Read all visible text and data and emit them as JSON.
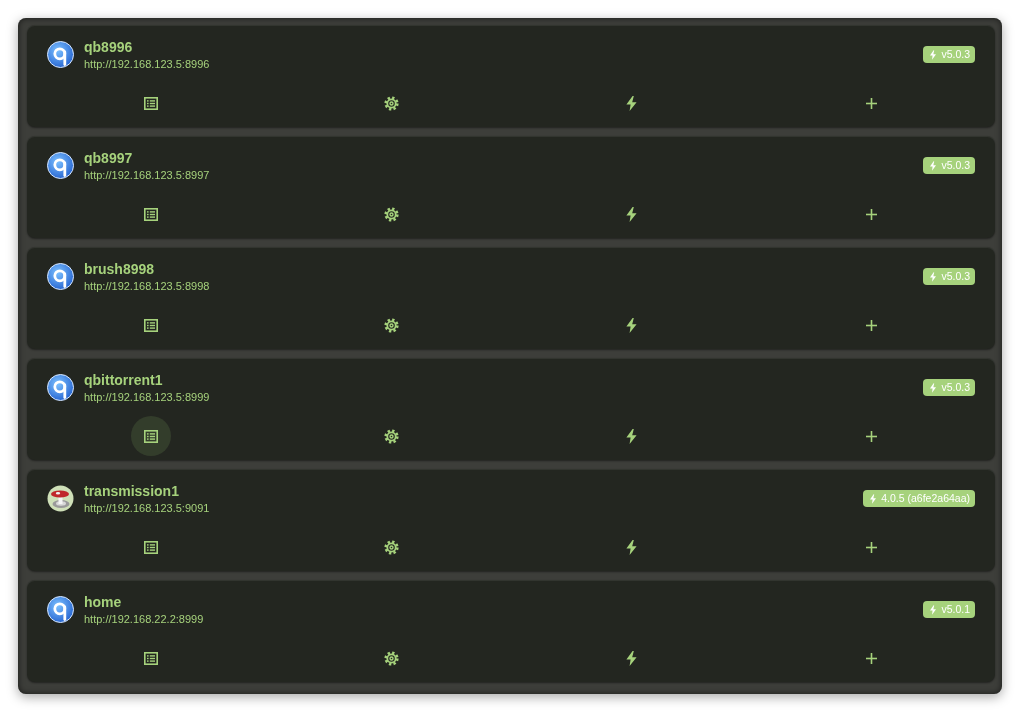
{
  "servers": [
    {
      "kind": "qbittorrent",
      "name": "qb8996",
      "url": "http://192.168.123.5:8996",
      "version": "v5.0.3",
      "actions": [
        {
          "kind": "list",
          "focused": false
        },
        {
          "kind": "settings",
          "focused": false
        },
        {
          "kind": "bolt",
          "focused": false
        },
        {
          "kind": "add",
          "focused": false
        }
      ]
    },
    {
      "kind": "qbittorrent",
      "name": "qb8997",
      "url": "http://192.168.123.5:8997",
      "version": "v5.0.3",
      "actions": [
        {
          "kind": "list",
          "focused": false
        },
        {
          "kind": "settings",
          "focused": false
        },
        {
          "kind": "bolt",
          "focused": false
        },
        {
          "kind": "add",
          "focused": false
        }
      ]
    },
    {
      "kind": "qbittorrent",
      "name": "brush8998",
      "url": "http://192.168.123.5:8998",
      "version": "v5.0.3",
      "actions": [
        {
          "kind": "list",
          "focused": false
        },
        {
          "kind": "settings",
          "focused": false
        },
        {
          "kind": "bolt",
          "focused": false
        },
        {
          "kind": "add",
          "focused": false
        }
      ]
    },
    {
      "kind": "qbittorrent",
      "name": "qbittorrent1",
      "url": "http://192.168.123.5:8999",
      "version": "v5.0.3",
      "actions": [
        {
          "kind": "list",
          "focused": true
        },
        {
          "kind": "settings",
          "focused": false
        },
        {
          "kind": "bolt",
          "focused": false
        },
        {
          "kind": "add",
          "focused": false
        }
      ]
    },
    {
      "kind": "transmission",
      "name": "transmission1",
      "url": "http://192.168.123.5:9091",
      "version": "4.0.5 (a6fe2a64aa)",
      "actions": [
        {
          "kind": "list",
          "focused": false
        },
        {
          "kind": "settings",
          "focused": false
        },
        {
          "kind": "bolt",
          "focused": false
        },
        {
          "kind": "add",
          "focused": false
        }
      ]
    },
    {
      "kind": "qbittorrent",
      "name": "home",
      "url": "http://192.168.22.2:8999",
      "version": "v5.0.1",
      "actions": [
        {
          "kind": "list",
          "focused": false
        },
        {
          "kind": "settings",
          "focused": false
        },
        {
          "kind": "bolt",
          "focused": false
        },
        {
          "kind": "add",
          "focused": false
        }
      ]
    }
  ]
}
